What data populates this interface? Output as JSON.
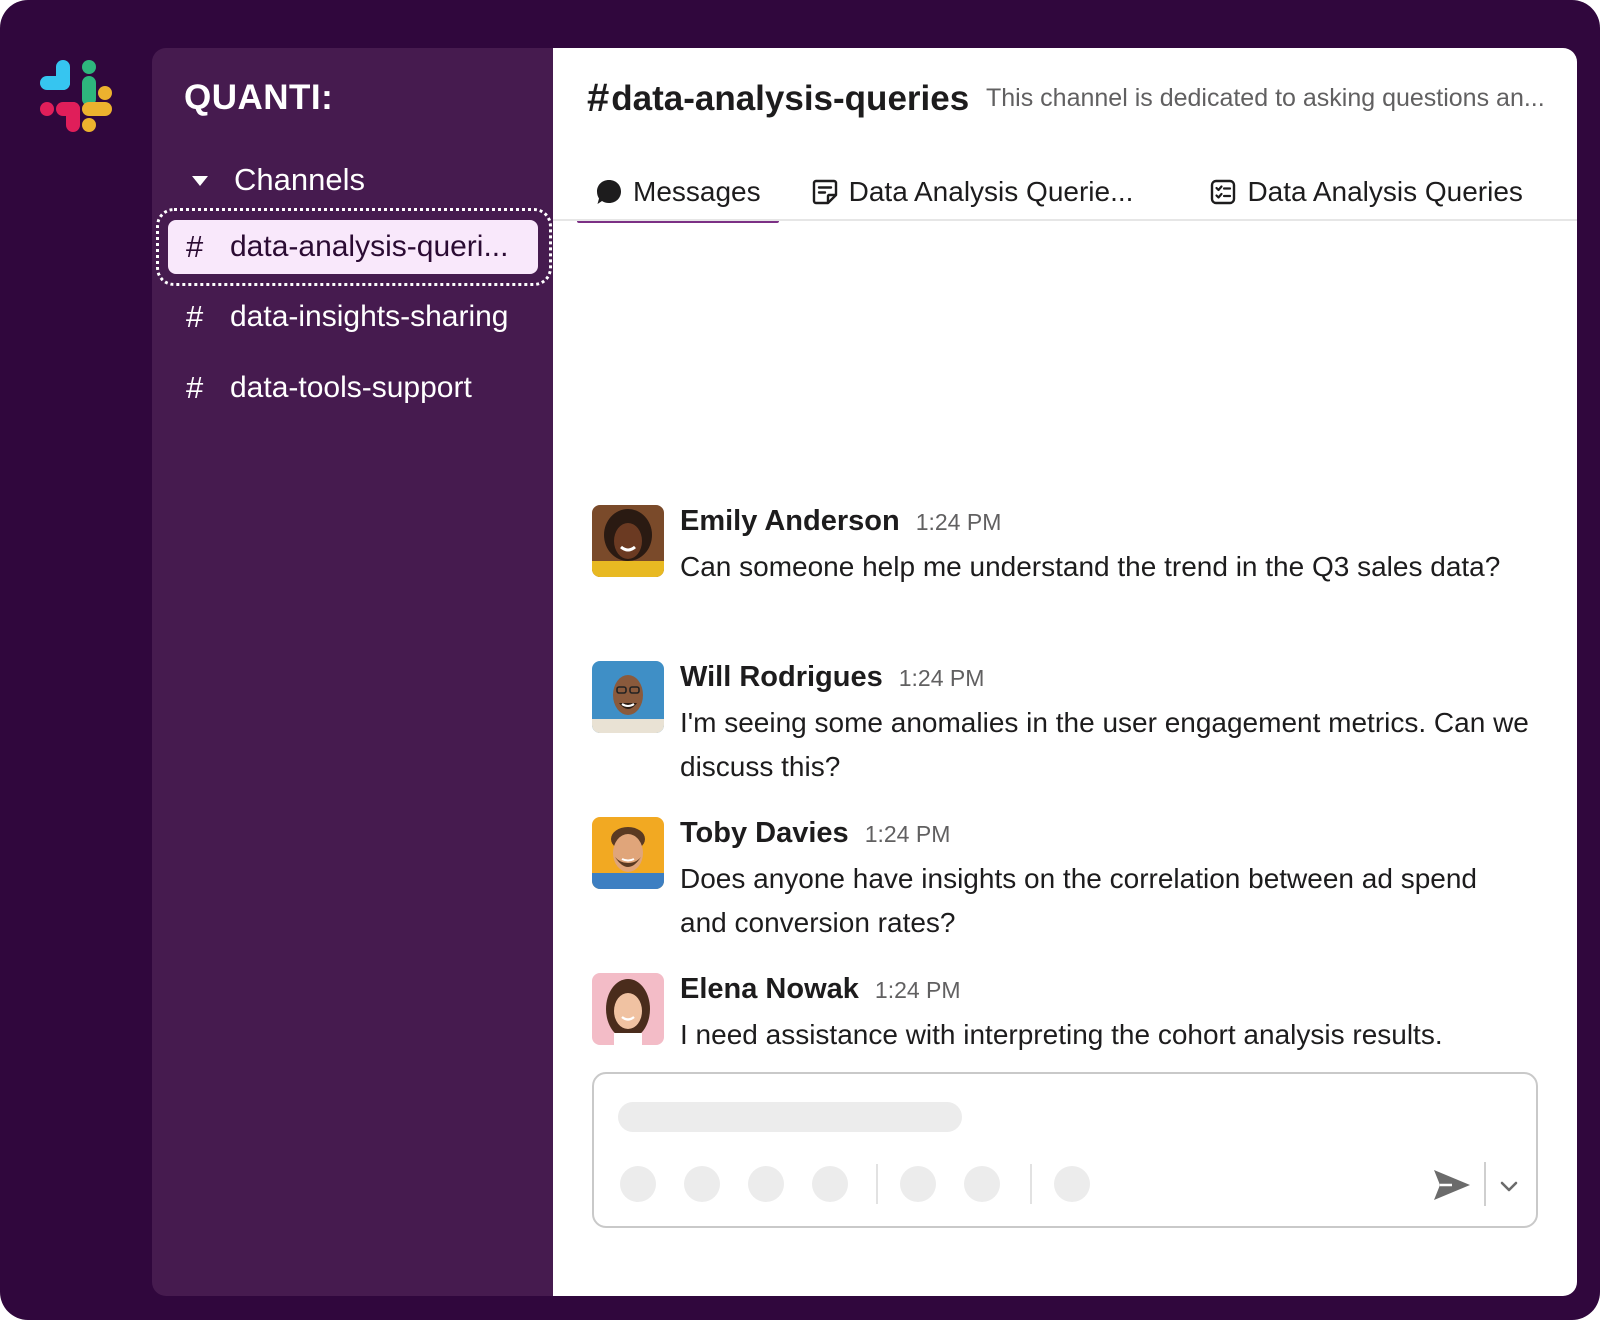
{
  "app": {
    "logo_icon": "slack-logo-icon",
    "colors": {
      "frame": "#30073d",
      "sidebar": "#461b4f",
      "active_channel_bg": "#f9e8fb",
      "tab_accent": "#7c3085"
    }
  },
  "sidebar": {
    "workspace_name": "QUANTI:",
    "section_label": "Channels",
    "channels": [
      {
        "hash": "#",
        "name": "data-analysis-queries",
        "display": "data-analysis-queri...",
        "active": true
      },
      {
        "hash": "#",
        "name": "data-insights-sharing",
        "display": "data-insights-sharing",
        "active": false
      },
      {
        "hash": "#",
        "name": "data-tools-support",
        "display": "data-tools-support",
        "active": false
      }
    ]
  },
  "header": {
    "hash": "#",
    "channel_name": "data-analysis-queries",
    "description": "This channel is dedicated to asking questions an..."
  },
  "tabs": [
    {
      "label": "Messages",
      "icon": "message-bubble-icon",
      "active": true
    },
    {
      "label": "Data Analysis Querie...",
      "icon": "canvas-icon",
      "active": false
    },
    {
      "label": "Data Analysis Queries",
      "icon": "list-icon",
      "active": false
    }
  ],
  "messages": [
    {
      "sender": "Emily Anderson",
      "time": "1:24 PM",
      "text": "Can someone help me understand the trend in the Q3 sales data?",
      "avatar_bg": "#d9892c"
    },
    {
      "sender": "Will Rodrigues",
      "time": "1:24 PM",
      "text": "I'm seeing some anomalies in the user engagement metrics. Can we discuss this?",
      "avatar_bg": "#3f8fc6"
    },
    {
      "sender": "Toby Davies",
      "time": "1:24 PM",
      "text": "Does anyone have insights on the correlation between ad spend and conversion rates?",
      "avatar_bg": "#f2a922"
    },
    {
      "sender": "Elena Nowak",
      "time": "1:24 PM",
      "text": "I need assistance with interpreting the cohort analysis results.",
      "avatar_bg": "#f3bcc7"
    }
  ],
  "composer": {
    "send_icon": "send-icon",
    "options_icon": "chevron-down-icon"
  }
}
